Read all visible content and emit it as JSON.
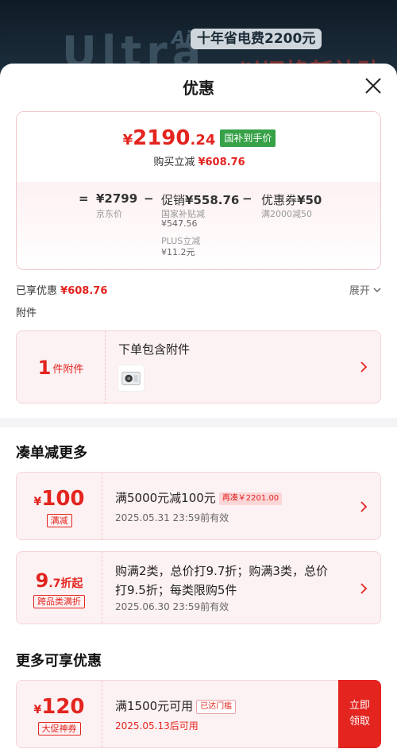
{
  "background": {
    "ad_big_text": "Ultra",
    "ad_ai_text": "Ai",
    "ad_slogan": "十年省电费2200元",
    "ad_slogan2": "以旧换新补贴"
  },
  "sheet": {
    "title": "优惠",
    "close_icon": "close-icon"
  },
  "price": {
    "currency": "¥",
    "price_int": "2190",
    "price_dec": ".24",
    "price_tag": "国补到手价",
    "instant_discount_label": "购买立减",
    "instant_discount_value": "¥608.76",
    "formula": {
      "equals": "=",
      "base_price": "¥2799",
      "base_label": "京东价",
      "minus1": "−",
      "promo_label": "促销",
      "promo_value": "¥558.76",
      "subsidy_label": "国家补贴减",
      "subsidy_value": "¥547.56",
      "plus_label": "PLUS立减",
      "plus_value": "¥11.2元",
      "minus2": "−",
      "coupon_label": "优惠券",
      "coupon_value": "¥50",
      "coupon_cond": "满2000减50"
    }
  },
  "enjoyed": {
    "label": "已享优惠",
    "value": "¥608.76",
    "expand_label": "展开"
  },
  "accessory": {
    "section_label": "附件",
    "count": "1",
    "unit": "件附件",
    "title": "下单包含附件"
  },
  "sections": {
    "more_order_title": "凑单减更多",
    "more_offers_title": "更多可享优惠"
  },
  "coupons": [
    {
      "symbol": "¥",
      "amount": "100",
      "amount_suffix": "",
      "type": "满减",
      "desc": "满5000元减100元",
      "tag": "再凑￥2201.00",
      "date": "2025.05.31  23:59前有效"
    },
    {
      "symbol": "",
      "amount": "9",
      "amount_suffix": ".7折起",
      "type": "跨品类满折",
      "desc_line1": "购满2类，总价打9.7折；购满3类，总价",
      "desc_line2": "打9.5折；每类限购5件",
      "date": "2025.06.30  23:59前有效"
    },
    {
      "symbol": "¥",
      "amount": "120",
      "type": "大促神券",
      "desc": "满1500元可用",
      "tag": "已达门槛",
      "date": "2025.05.13后可用",
      "claim_line1": "立即",
      "claim_line2": "领取"
    }
  ],
  "colors": {
    "accent": "#e3241f",
    "green_tag": "#37a148"
  }
}
